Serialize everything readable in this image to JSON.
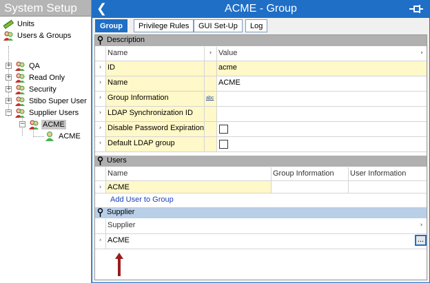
{
  "left": {
    "title": "System Setup",
    "tree": [
      {
        "label": "Units",
        "icon": "units-icon"
      },
      {
        "label": "Users & Groups",
        "icon": "users-groups-icon"
      },
      {
        "label": "QA",
        "icon": "group-icon",
        "expander": "+"
      },
      {
        "label": "Read Only",
        "icon": "group-icon",
        "expander": "+"
      },
      {
        "label": "Security",
        "icon": "group-icon",
        "expander": "+"
      },
      {
        "label": "Stibo Super User",
        "icon": "group-icon",
        "expander": "+"
      },
      {
        "label": "Supplier Users",
        "icon": "group-icon",
        "expander": "−"
      },
      {
        "label": "ACME",
        "icon": "group-icon",
        "expander": "−",
        "selected": true
      },
      {
        "label": "ACME",
        "icon": "user-icon"
      }
    ]
  },
  "header": {
    "back": "❮",
    "title": "ACME - Group",
    "pin": "pin-icon"
  },
  "tabs": [
    {
      "label": "Group",
      "active": true
    },
    {
      "label": "Privilege Rules"
    },
    {
      "label": "GUI Set-Up"
    },
    {
      "label": "Log"
    }
  ],
  "description": {
    "heading": "Description",
    "col_name": "Name",
    "col_arrow": "›",
    "col_value": "Value",
    "col_value_arrow": "›",
    "rows": [
      {
        "name": "ID",
        "value": "acme"
      },
      {
        "name": "Name",
        "value": "ACME"
      },
      {
        "name": "Group Information",
        "value": "",
        "badge": "abc"
      },
      {
        "name": "LDAP Synchronization ID",
        "value": ""
      },
      {
        "name": "Disable Password Expiration",
        "checkbox": false
      },
      {
        "name": "Default LDAP group",
        "checkbox": false
      }
    ]
  },
  "users": {
    "heading": "Users",
    "columns": [
      "Name",
      "Group Information",
      "User Information"
    ],
    "rows": [
      {
        "name": "ACME",
        "group_info": "",
        "user_info": ""
      }
    ],
    "add_link": "Add User to Group"
  },
  "supplier": {
    "heading": "Supplier",
    "col": "Supplier",
    "value": "ACME",
    "button": "..."
  },
  "gutter_arrow": "›",
  "colors": {
    "accent": "#1f6fc6",
    "yellow": "#fff8c8",
    "arrow": "#9b1c1c"
  }
}
